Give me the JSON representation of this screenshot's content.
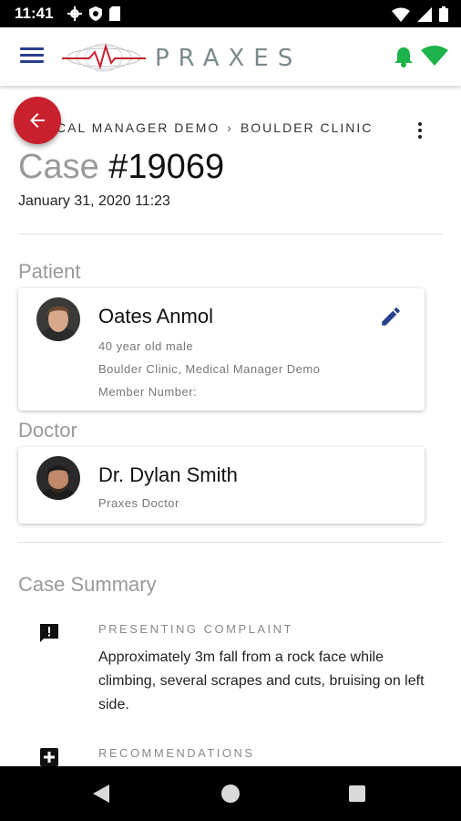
{
  "status_bar": {
    "time": "11:41",
    "left_icons": [
      "gear-icon",
      "shield-icon",
      "sd-card-icon"
    ],
    "right_icons": [
      "wifi-icon",
      "signal-icon",
      "battery-icon"
    ]
  },
  "app_bar": {
    "logo_text": "PRAXES",
    "accent_color": "#27408b",
    "notification_color": "#1db34b"
  },
  "breadcrumb": {
    "items": [
      "CAL MANAGER DEMO",
      "BOULDER CLINIC"
    ],
    "separator": "›"
  },
  "case": {
    "label": "Case",
    "number": "#19069",
    "date": "January 31, 2020 11:23"
  },
  "patient": {
    "section_label": "Patient",
    "name": "Oates Anmol",
    "details": "40 year old male",
    "location": "Boulder Clinic, Medical Manager Demo",
    "member_number": "Member Number:"
  },
  "doctor": {
    "section_label": "Doctor",
    "name": "Dr. Dylan Smith",
    "role": "Praxes Doctor"
  },
  "case_summary": {
    "section_label": "Case Summary",
    "presenting_complaint": {
      "heading": "PRESENTING COMPLAINT",
      "text": "Approximately 3m fall from a rock face while climbing, several scrapes and cuts, bruising on left side."
    },
    "recommendations": {
      "heading": "RECOMMENDATIONS"
    }
  },
  "colors": {
    "back_button": "#c8202d",
    "muted_text": "#9a9a9a"
  }
}
